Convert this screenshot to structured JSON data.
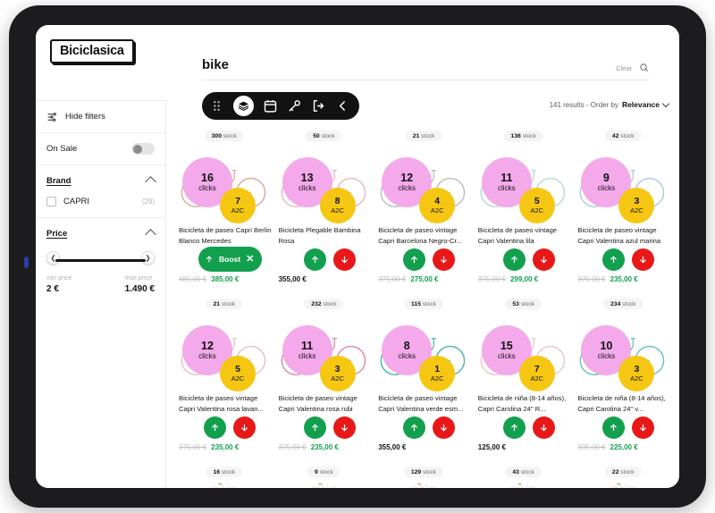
{
  "app": {
    "brand": "Biciclasica",
    "lock_icon": "lock-icon",
    "close_label": "✕"
  },
  "sidebar": {
    "hide_filters": "Hide filters",
    "filters_icon": "filter-sliders-icon",
    "on_sale": "On Sale",
    "brand_section": "Brand",
    "brand_options": [
      {
        "label": "CAPRI",
        "count": "(29)"
      }
    ],
    "price_section": "Price",
    "min_caption": "min price",
    "min_value": "2 €",
    "max_caption": "max price",
    "max_value": "1.490 €",
    "slider_left_icon": "chevron-left-icon",
    "slider_right_icon": "chevron-right-icon"
  },
  "search": {
    "value": "bike",
    "clear_label": "Clear",
    "icon": "search-icon"
  },
  "toolbar": {
    "items": [
      {
        "name": "drag-handle-icon",
        "label": ""
      },
      {
        "name": "layers-icon",
        "label": ""
      },
      {
        "name": "calendar-icon",
        "label": ""
      },
      {
        "name": "key-icon",
        "label": ""
      },
      {
        "name": "logout-icon",
        "label": ""
      },
      {
        "name": "chevron-left-icon",
        "label": ""
      }
    ]
  },
  "results": {
    "count_text": "141 results - Order by",
    "sort_value": "Relevance"
  },
  "products": [
    {
      "stock": "300",
      "stock_suffix": "stock",
      "clicks": "16",
      "clicks_label": "clicks",
      "a2c": "7",
      "a2c_label": "A2C",
      "title": "Bicicleta de paseo Capri Berlin Blanco Mercedes",
      "price_old": "465,00 €",
      "price_new": "385,00 €",
      "boost_label": "Boost",
      "has_boost": true,
      "color": "#d8a7a0"
    },
    {
      "stock": "50",
      "stock_suffix": "stock",
      "clicks": "13",
      "clicks_label": "clicks",
      "a2c": "8",
      "a2c_label": "A2C",
      "title": "Bicicleta Plegable Bambina Rosa",
      "price_plain": "355,00 €",
      "has_boost": false,
      "color": "#e7b6c2"
    },
    {
      "stock": "21",
      "stock_suffix": "stock",
      "clicks": "12",
      "clicks_label": "clicks",
      "a2c": "4",
      "a2c_label": "A2C",
      "title": "Bicicleta de paseo vintage Capri Barcelona Negro-Cr...",
      "price_old": "375,00 €",
      "price_new": "275,00 €",
      "has_boost": false,
      "color": "#b9bcbd"
    },
    {
      "stock": "136",
      "stock_suffix": "stock",
      "clicks": "11",
      "clicks_label": "clicks",
      "a2c": "5",
      "a2c_label": "A2C",
      "title": "Bicicleta de paseo vintage Capri Valentina lila",
      "price_old": "375,00 €",
      "price_new": "299,00 €",
      "has_boost": false,
      "color": "#b7d8d4"
    },
    {
      "stock": "42",
      "stock_suffix": "stock",
      "clicks": "9",
      "clicks_label": "clicks",
      "a2c": "3",
      "a2c_label": "A2C",
      "title": "Bicicleta de paseo vintage Capri Valentina azul marina",
      "price_old": "375,00 €",
      "price_new": "235,00 €",
      "has_boost": false,
      "color": "#a9ccd4"
    },
    {
      "stock": "21",
      "stock_suffix": "stock",
      "clicks": "12",
      "clicks_label": "clicks",
      "a2c": "5",
      "a2c_label": "A2C",
      "title": "Bicicleta de paseo vintage Capri Valentina rosa lavan...",
      "price_old": "375,00 €",
      "price_new": "235,00 €",
      "has_boost": false,
      "color": "#e6c0c4"
    },
    {
      "stock": "232",
      "stock_suffix": "stock",
      "clicks": "11",
      "clicks_label": "clicks",
      "a2c": "3",
      "a2c_label": "A2C",
      "title": "Bicicleta de paseo vintage Capri Valentina rosa rubi",
      "price_old": "375,00 €",
      "price_new": "235,00 €",
      "has_boost": false,
      "color": "#d9899f"
    },
    {
      "stock": "115",
      "stock_suffix": "stock",
      "clicks": "8",
      "clicks_label": "clicks",
      "a2c": "1",
      "a2c_label": "A2C",
      "title": "Bicicleta de paseo vintage Capri Valentina verde esm...",
      "price_plain": "355,00 €",
      "has_boost": false,
      "color": "#49b3a6"
    },
    {
      "stock": "53",
      "stock_suffix": "stock",
      "clicks": "15",
      "clicks_label": "clicks",
      "a2c": "7",
      "a2c_label": "A2C",
      "title": "Bicicleta de niña (8-14 años), Capri Carolina 24\" R...",
      "price_plain": "125,00 €",
      "has_boost": false,
      "color": "#e8c6c8"
    },
    {
      "stock": "234",
      "stock_suffix": "stock",
      "clicks": "10",
      "clicks_label": "clicks",
      "a2c": "3",
      "a2c_label": "A2C",
      "title": "Bicicleta de niña (8-14 años), Capri Carolina 24\" v...",
      "price_old": "335,00 €",
      "price_new": "225,00 €",
      "has_boost": false,
      "color": "#63c3b4"
    }
  ],
  "next_row_stocks": [
    {
      "stock": "16",
      "stock_suffix": "stock"
    },
    {
      "stock": "9",
      "stock_suffix": "stock"
    },
    {
      "stock": "129",
      "stock_suffix": "stock"
    },
    {
      "stock": "43",
      "stock_suffix": "stock"
    },
    {
      "stock": "22",
      "stock_suffix": "stock"
    }
  ],
  "colors": {
    "accent_pink": "#f3a9ea",
    "accent_yellow": "#f6c712",
    "up_green": "#13a04e",
    "down_red": "#e81818",
    "dark": "#121212"
  }
}
